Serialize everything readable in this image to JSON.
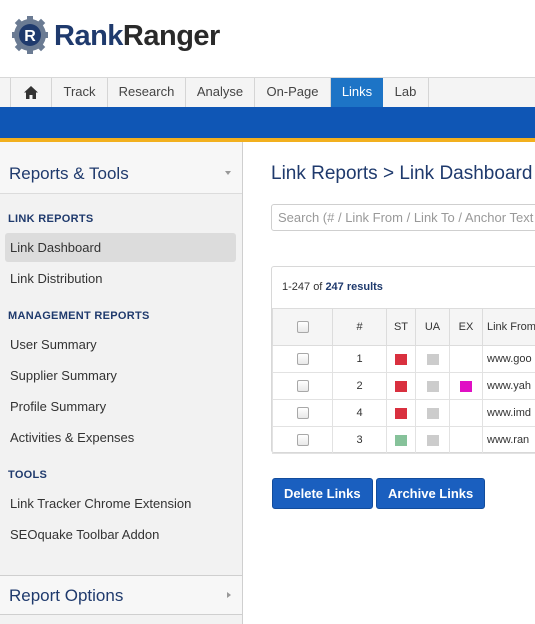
{
  "brand": {
    "part1": "Rank",
    "part2": "Ranger",
    "accent": "#1f3a6d"
  },
  "nav": {
    "home_icon": "home-icon",
    "items": [
      {
        "label": "Track",
        "active": false
      },
      {
        "label": "Research",
        "active": false
      },
      {
        "label": "Analyse",
        "active": false
      },
      {
        "label": "On-Page",
        "active": false
      },
      {
        "label": "Links",
        "active": true
      },
      {
        "label": "Lab",
        "active": false
      }
    ],
    "active_color": "#1d74c6"
  },
  "sidebar": {
    "title": "Reports & Tools",
    "sections": [
      {
        "heading": "LINK REPORTS",
        "items": [
          "Link Dashboard",
          "Link Distribution"
        ]
      },
      {
        "heading": "MANAGEMENT REPORTS",
        "items": [
          "User Summary",
          "Supplier Summary",
          "Profile Summary",
          "Activities & Expenses"
        ]
      },
      {
        "heading": "TOOLS",
        "items": [
          "Link Tracker Chrome Extension",
          "SEOquake Toolbar Addon"
        ]
      }
    ],
    "active_item": "Link Dashboard",
    "footer_title": "Report Options"
  },
  "main": {
    "title": "Link Reports > Link Dashboard",
    "search_placeholder": "Search (# / Link From / Link To / Anchor Text",
    "results": {
      "range": "1-247 of",
      "total": "247 results"
    },
    "columns": [
      "#",
      "ST",
      "UA",
      "EX",
      "Link From"
    ],
    "rows": [
      {
        "num": "1",
        "st": "#d9303f",
        "ua": "#cccccc",
        "ex": "",
        "link": "www.goo"
      },
      {
        "num": "2",
        "st": "#d9303f",
        "ua": "#cccccc",
        "ex": "#e00fc4",
        "link": "www.yah"
      },
      {
        "num": "4",
        "st": "#d9303f",
        "ua": "#cccccc",
        "ex": "",
        "link": "www.imd"
      },
      {
        "num": "3",
        "st": "#86c29a",
        "ua": "#cccccc",
        "ex": "",
        "link": "www.ran"
      }
    ],
    "buttons": {
      "delete": "Delete Links",
      "archive": "Archive Links"
    }
  }
}
